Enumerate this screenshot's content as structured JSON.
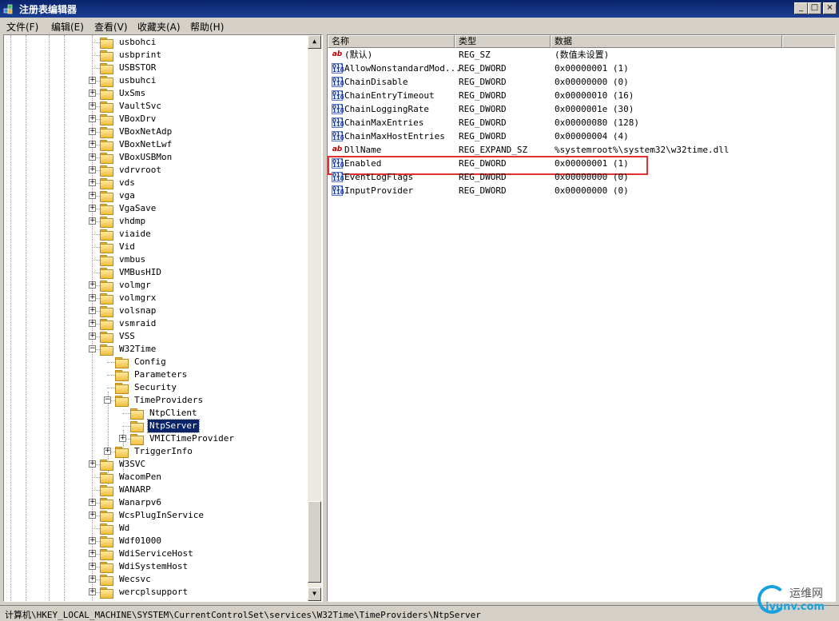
{
  "window": {
    "title": "注册表编辑器",
    "min_label": "_",
    "max_label": "□",
    "close_label": "×"
  },
  "menu": {
    "items": [
      "文件(F)",
      "编辑(E)",
      "查看(V)",
      "收藏夹(A)",
      "帮助(H)"
    ]
  },
  "tree": {
    "nodes": [
      {
        "label": "usbohci",
        "expandable": false,
        "level": 0
      },
      {
        "label": "usbprint",
        "expandable": false,
        "level": 0
      },
      {
        "label": "USBSTOR",
        "expandable": false,
        "level": 0
      },
      {
        "label": "usbuhci",
        "expandable": true,
        "level": 0
      },
      {
        "label": "UxSms",
        "expandable": true,
        "level": 0
      },
      {
        "label": "VaultSvc",
        "expandable": true,
        "level": 0
      },
      {
        "label": "VBoxDrv",
        "expandable": true,
        "level": 0
      },
      {
        "label": "VBoxNetAdp",
        "expandable": true,
        "level": 0
      },
      {
        "label": "VBoxNetLwf",
        "expandable": true,
        "level": 0
      },
      {
        "label": "VBoxUSBMon",
        "expandable": true,
        "level": 0
      },
      {
        "label": "vdrvroot",
        "expandable": true,
        "level": 0
      },
      {
        "label": "vds",
        "expandable": true,
        "level": 0
      },
      {
        "label": "vga",
        "expandable": true,
        "level": 0
      },
      {
        "label": "VgaSave",
        "expandable": true,
        "level": 0
      },
      {
        "label": "vhdmp",
        "expandable": true,
        "level": 0
      },
      {
        "label": "viaide",
        "expandable": false,
        "level": 0
      },
      {
        "label": "Vid",
        "expandable": false,
        "level": 0
      },
      {
        "label": "vmbus",
        "expandable": false,
        "level": 0
      },
      {
        "label": "VMBusHID",
        "expandable": false,
        "level": 0
      },
      {
        "label": "volmgr",
        "expandable": true,
        "level": 0
      },
      {
        "label": "volmgrx",
        "expandable": true,
        "level": 0
      },
      {
        "label": "volsnap",
        "expandable": true,
        "level": 0
      },
      {
        "label": "vsmraid",
        "expandable": true,
        "level": 0
      },
      {
        "label": "VSS",
        "expandable": true,
        "level": 0
      },
      {
        "label": "W32Time",
        "expandable": true,
        "expanded": true,
        "level": 0
      },
      {
        "label": "Config",
        "expandable": false,
        "level": 1
      },
      {
        "label": "Parameters",
        "expandable": false,
        "level": 1
      },
      {
        "label": "Security",
        "expandable": false,
        "level": 1
      },
      {
        "label": "TimeProviders",
        "expandable": true,
        "expanded": true,
        "level": 1
      },
      {
        "label": "NtpClient",
        "expandable": false,
        "level": 2
      },
      {
        "label": "NtpServer",
        "expandable": false,
        "level": 2,
        "selected": true
      },
      {
        "label": "VMICTimeProvider",
        "expandable": true,
        "level": 2
      },
      {
        "label": "TriggerInfo",
        "expandable": true,
        "level": 1
      },
      {
        "label": "W3SVC",
        "expandable": true,
        "level": 0
      },
      {
        "label": "WacomPen",
        "expandable": false,
        "level": 0
      },
      {
        "label": "WANARP",
        "expandable": false,
        "level": 0
      },
      {
        "label": "Wanarpv6",
        "expandable": true,
        "level": 0
      },
      {
        "label": "WcsPlugInService",
        "expandable": true,
        "level": 0
      },
      {
        "label": "Wd",
        "expandable": false,
        "level": 0
      },
      {
        "label": "Wdf01000",
        "expandable": true,
        "level": 0
      },
      {
        "label": "WdiServiceHost",
        "expandable": true,
        "level": 0
      },
      {
        "label": "WdiSystemHost",
        "expandable": true,
        "level": 0
      },
      {
        "label": "Wecsvc",
        "expandable": true,
        "level": 0
      },
      {
        "label": "wercplsupport",
        "expandable": true,
        "level": 0
      }
    ]
  },
  "list": {
    "columns": {
      "name": "名称",
      "type": "类型",
      "data": "数据"
    },
    "rows": [
      {
        "icon": "string-value-icon",
        "name": "(默认)",
        "type": "REG_SZ",
        "data": "(数值未设置)"
      },
      {
        "icon": "dword-value-icon",
        "name": "AllowNonstandardMod...",
        "type": "REG_DWORD",
        "data": "0x00000001 (1)"
      },
      {
        "icon": "dword-value-icon",
        "name": "ChainDisable",
        "type": "REG_DWORD",
        "data": "0x00000000 (0)"
      },
      {
        "icon": "dword-value-icon",
        "name": "ChainEntryTimeout",
        "type": "REG_DWORD",
        "data": "0x00000010 (16)"
      },
      {
        "icon": "dword-value-icon",
        "name": "ChainLoggingRate",
        "type": "REG_DWORD",
        "data": "0x0000001e (30)"
      },
      {
        "icon": "dword-value-icon",
        "name": "ChainMaxEntries",
        "type": "REG_DWORD",
        "data": "0x00000080 (128)"
      },
      {
        "icon": "dword-value-icon",
        "name": "ChainMaxHostEntries",
        "type": "REG_DWORD",
        "data": "0x00000004 (4)"
      },
      {
        "icon": "string-value-icon",
        "name": "DllName",
        "type": "REG_EXPAND_SZ",
        "data": "%systemroot%\\system32\\w32time.dll"
      },
      {
        "icon": "dword-value-icon",
        "name": "Enabled",
        "type": "REG_DWORD",
        "data": "0x00000001 (1)"
      },
      {
        "icon": "dword-value-icon",
        "name": "EventLogFlags",
        "type": "REG_DWORD",
        "data": "0x00000000 (0)"
      },
      {
        "icon": "dword-value-icon",
        "name": "InputProvider",
        "type": "REG_DWORD",
        "data": "0x00000000 (0)"
      }
    ]
  },
  "status": {
    "path": "计算机\\HKEY_LOCAL_MACHINE\\SYSTEM\\CurrentControlSet\\services\\W32Time\\TimeProviders\\NtpServer"
  },
  "watermark": {
    "top": "运维网",
    "bottom": "iyunv.com"
  },
  "colors": {
    "selection": "#0a246a",
    "highlight_box": "#e03030",
    "titlebar": "#0a246a"
  }
}
